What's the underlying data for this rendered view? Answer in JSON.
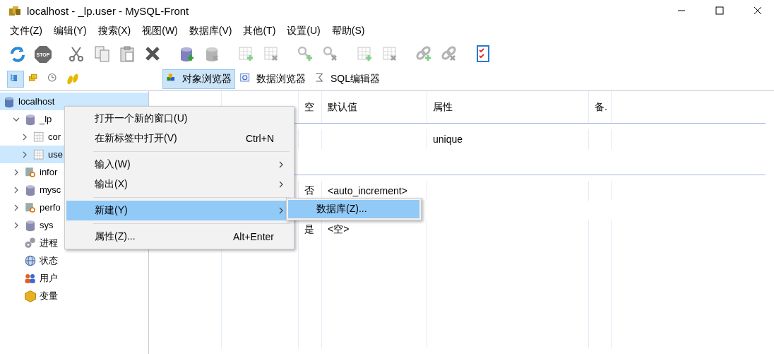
{
  "window": {
    "title": "localhost - _lp.user - MySQL-Front"
  },
  "menu_bar": [
    "文件(Z)",
    "编辑(Y)",
    "搜索(X)",
    "视图(W)",
    "数据库(V)",
    "其他(T)",
    "设置(U)",
    "帮助(S)"
  ],
  "toolbar": [
    [
      {
        "kind": "refresh",
        "disabled": false
      },
      {
        "kind": "stop",
        "label": "STOP",
        "disabled": false
      }
    ],
    [
      {
        "kind": "cut",
        "disabled": false
      },
      {
        "kind": "copy",
        "disabled": false
      },
      {
        "kind": "paste",
        "disabled": false
      },
      {
        "kind": "delete",
        "disabled": false
      }
    ],
    [
      {
        "kind": "db-add",
        "disabled": false
      },
      {
        "kind": "db-remove",
        "disabled": true
      }
    ],
    [
      {
        "kind": "table-add",
        "disabled": true
      },
      {
        "kind": "table-remove",
        "disabled": true
      }
    ],
    [
      {
        "kind": "key-add",
        "disabled": true
      },
      {
        "kind": "key-remove",
        "disabled": true
      }
    ],
    [
      {
        "kind": "table-add",
        "disabled": true
      },
      {
        "kind": "table-remove",
        "disabled": true
      }
    ],
    [
      {
        "kind": "link-add",
        "disabled": true
      },
      {
        "kind": "link-remove",
        "disabled": true
      }
    ],
    [
      {
        "kind": "checklist",
        "disabled": false
      }
    ]
  ],
  "view_toolbar": [
    {
      "kind": "tree",
      "selected": true
    },
    {
      "kind": "folders",
      "selected": false
    },
    {
      "kind": "clock",
      "selected": false
    },
    {
      "kind": "steps",
      "selected": false
    }
  ],
  "tabs": [
    {
      "label": "对象浏览器",
      "kind": "objects",
      "selected": true
    },
    {
      "label": "数据浏览器",
      "kind": "data",
      "selected": false
    },
    {
      "label": "SQL编辑器",
      "kind": "sql",
      "selected": false
    }
  ],
  "tree": [
    {
      "label": "localhost",
      "kind": "server",
      "selected": true,
      "children": [
        {
          "label": "_lp",
          "kind": "database",
          "expanded": true,
          "selected": false,
          "children": [
            {
              "label": "cor",
              "kind": "table",
              "expanded": false,
              "selected": false
            },
            {
              "label": "use",
              "kind": "table",
              "expanded": false,
              "selected": true
            }
          ]
        },
        {
          "label": "infor",
          "kind": "system-db",
          "expanded": false,
          "selected": false
        },
        {
          "label": "mysc",
          "kind": "database",
          "expanded": false,
          "selected": false
        },
        {
          "label": "perfo",
          "kind": "system-db",
          "expanded": false,
          "selected": false
        },
        {
          "label": "sys",
          "kind": "database",
          "expanded": false,
          "selected": false
        },
        {
          "label": "进程",
          "kind": "process",
          "selected": false
        },
        {
          "label": "状态",
          "kind": "status",
          "selected": false
        },
        {
          "label": "用户",
          "kind": "users",
          "selected": false
        },
        {
          "label": "变量",
          "kind": "variables",
          "selected": false
        }
      ]
    }
  ],
  "grid": {
    "columns": [
      "空",
      "默认值",
      "属性",
      "备."
    ],
    "sections": [
      {
        "rows": [
          {
            "attributes": "unique"
          }
        ]
      },
      {
        "rows": [
          {
            "nullable": "否",
            "default": "<auto_increment>"
          },
          {
            "nullable": "是",
            "default": "<空>"
          }
        ]
      }
    ]
  },
  "context_menu": {
    "items": [
      {
        "kind": "item",
        "label": "打开一个新的窗口(U)",
        "selected": false
      },
      {
        "kind": "item",
        "label": "在新标签中打开(V)",
        "shortcut": "Ctrl+N",
        "selected": false
      },
      {
        "kind": "separator"
      },
      {
        "kind": "item",
        "label": "输入(W)",
        "submenu": true,
        "selected": false
      },
      {
        "kind": "item",
        "label": "输出(X)",
        "submenu": true,
        "selected": false
      },
      {
        "kind": "separator"
      },
      {
        "kind": "item",
        "label": "新建(Y)",
        "submenu": true,
        "selected": true
      },
      {
        "kind": "separator"
      },
      {
        "kind": "item",
        "label": "属性(Z)...",
        "shortcut": "Alt+Enter",
        "selected": false
      }
    ],
    "submenu": [
      {
        "label": "数据库(Z)...",
        "selected": true
      }
    ]
  }
}
